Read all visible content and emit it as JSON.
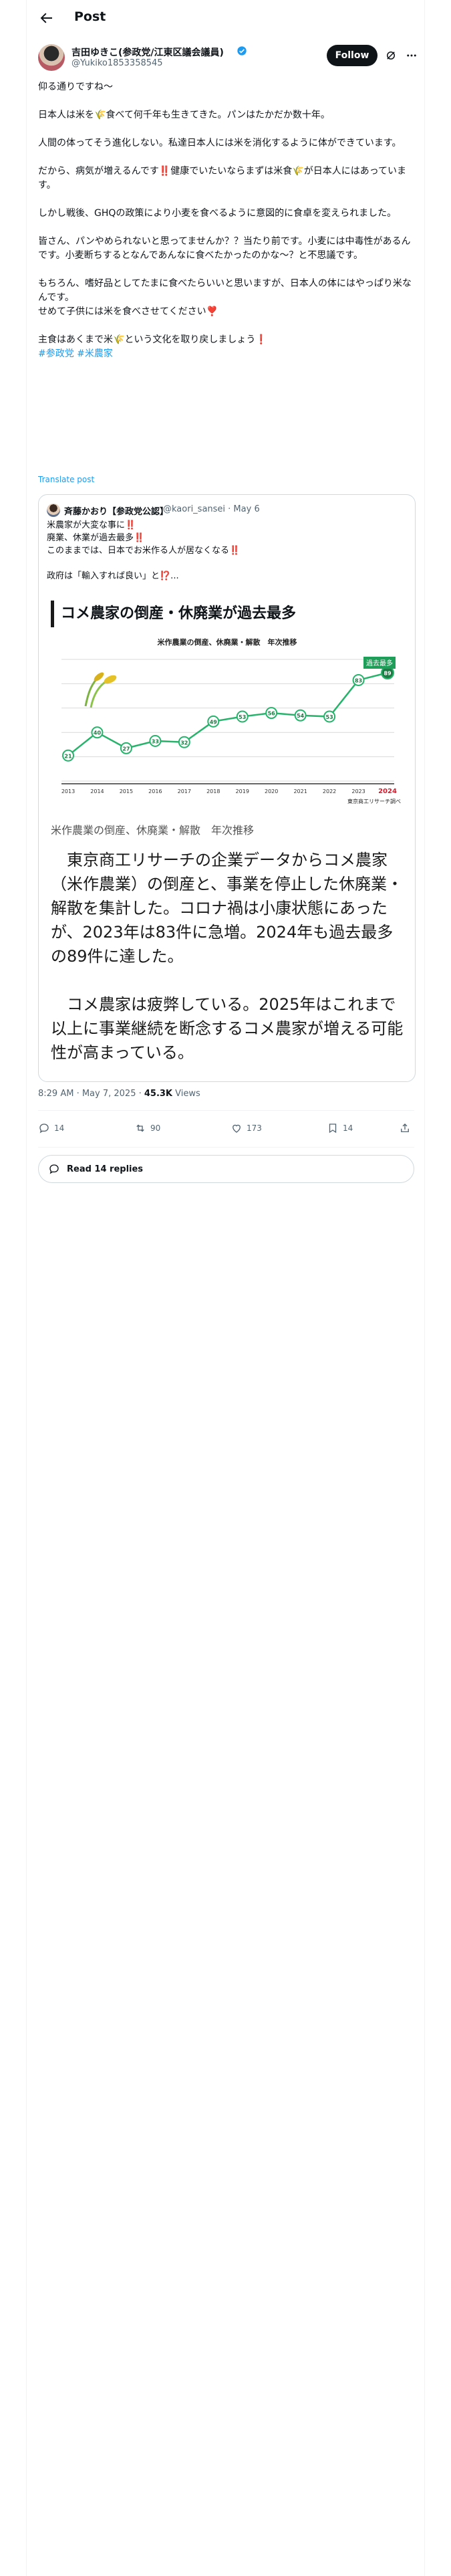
{
  "header": {
    "title": "Post"
  },
  "author": {
    "name": "吉田ゆきこ(参政党/江東区議会議員)",
    "handle": "@Yukiko1853358545",
    "follow_label": "Follow"
  },
  "post": {
    "paragraphs": [
      [
        "仰る通りですね〜"
      ],
      [
        "日本人は米を🌾食べて何千年も生きてきた。パンはたかだか数十年。"
      ],
      [
        "人間の体ってそう進化しない。私達日本人には米を消化するように体ができています。"
      ],
      [
        "だから、病気が増えるんです‼️健康でいたいならまずは米食🌾が日本人にはあっています。"
      ],
      [
        "しかし戦後、GHQの政策により小麦を食べるように意図的に食卓を変えられました。"
      ],
      [
        "皆さん、パンやめられないと思ってませんか？？当たり前です。小麦には中毒性があるんです。小麦断ちするとなんであんなに食べたかったのかな〜？と不思議です。"
      ],
      [
        "もちろん、嗜好品としてたまに食べたらいいと思いますが、日本人の体にはやっぱり米なんです。",
        "せめて子供には米を食べさせてください❣️"
      ],
      [
        "主食はあくまで米🌾という文化を取り戻しましょう❗️"
      ]
    ],
    "hashtags": "#参政党 #米農家",
    "translate_label": "Translate post"
  },
  "quote": {
    "name": "斉藤かおり【参政党公認】",
    "handle": "@kaori_sansei · May 6",
    "lines": [
      "米農家が大変な事に‼️",
      "廃業、休業が過去最多‼️",
      "このままでは、日本でお米作る人が居なくなる‼️"
    ],
    "line_after_gap": "政府は「輸入すれば良い」と⁉️...",
    "image": {
      "title": "コメ農家の倒産・休廃業が過去最多",
      "caption": "米作農業の倒産、休廃業・解散　年次推移",
      "article_p1": "東京商工リサーチの企業データからコメ農家（米作農業）の倒産と、事業を停止した休廃業・解散を集計した。コロナ禍は小康状態にあったが、2023年は83件に急増。2024年も過去最多の89件に達した。",
      "article_p2": "コメ農家は疲弊している。2025年はこれまで以上に事業継続を断念するコメ農家が増える可能性が高まっている。"
    }
  },
  "chart_data": {
    "type": "line",
    "title": "米作農業の倒産、休廃業・解散　年次推移",
    "x": [
      "2013",
      "2014",
      "2015",
      "2016",
      "2017",
      "2018",
      "2019",
      "2020",
      "2021",
      "2022",
      "2023",
      "2024"
    ],
    "values": [
      21,
      40,
      27,
      33,
      32,
      49,
      53,
      56,
      54,
      53,
      83,
      89
    ],
    "highlight_label": "過去最多",
    "source": "東京商工リサーチ調べ",
    "ylim": [
      0,
      100
    ],
    "grid": true,
    "colors": {
      "line": "#27b36b",
      "highlight_bg": "#1e9e58",
      "last_year": "#d21c2d"
    }
  },
  "meta": {
    "time": "8:29 AM · May 7, 2025 · ",
    "views_count": "45.3K",
    "views_label": " Views"
  },
  "actions": {
    "replies": "14",
    "reposts": "90",
    "likes": "173",
    "bookmarks": "14"
  },
  "read_replies": "Read 14 replies"
}
